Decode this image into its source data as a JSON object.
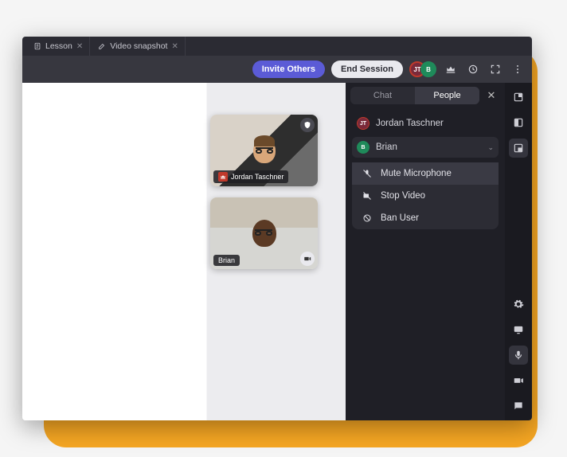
{
  "tabs": [
    {
      "label": "Lesson",
      "icon": "doc"
    },
    {
      "label": "Video snapshot",
      "icon": "edit"
    }
  ],
  "toolbar": {
    "invite_label": "Invite Others",
    "end_label": "End Session",
    "host_initials": "JT",
    "guest_initial": "B"
  },
  "videos": {
    "tile1_name": "Jordan Taschner",
    "tile2_name": "Brian"
  },
  "side": {
    "tab_chat": "Chat",
    "tab_people": "People",
    "person1": "Jordan Taschner",
    "person1_initials": "JT",
    "person2": "Brian",
    "person2_initial": "B",
    "action_mute": "Mute Microphone",
    "action_stop": "Stop Video",
    "action_ban": "Ban User"
  }
}
